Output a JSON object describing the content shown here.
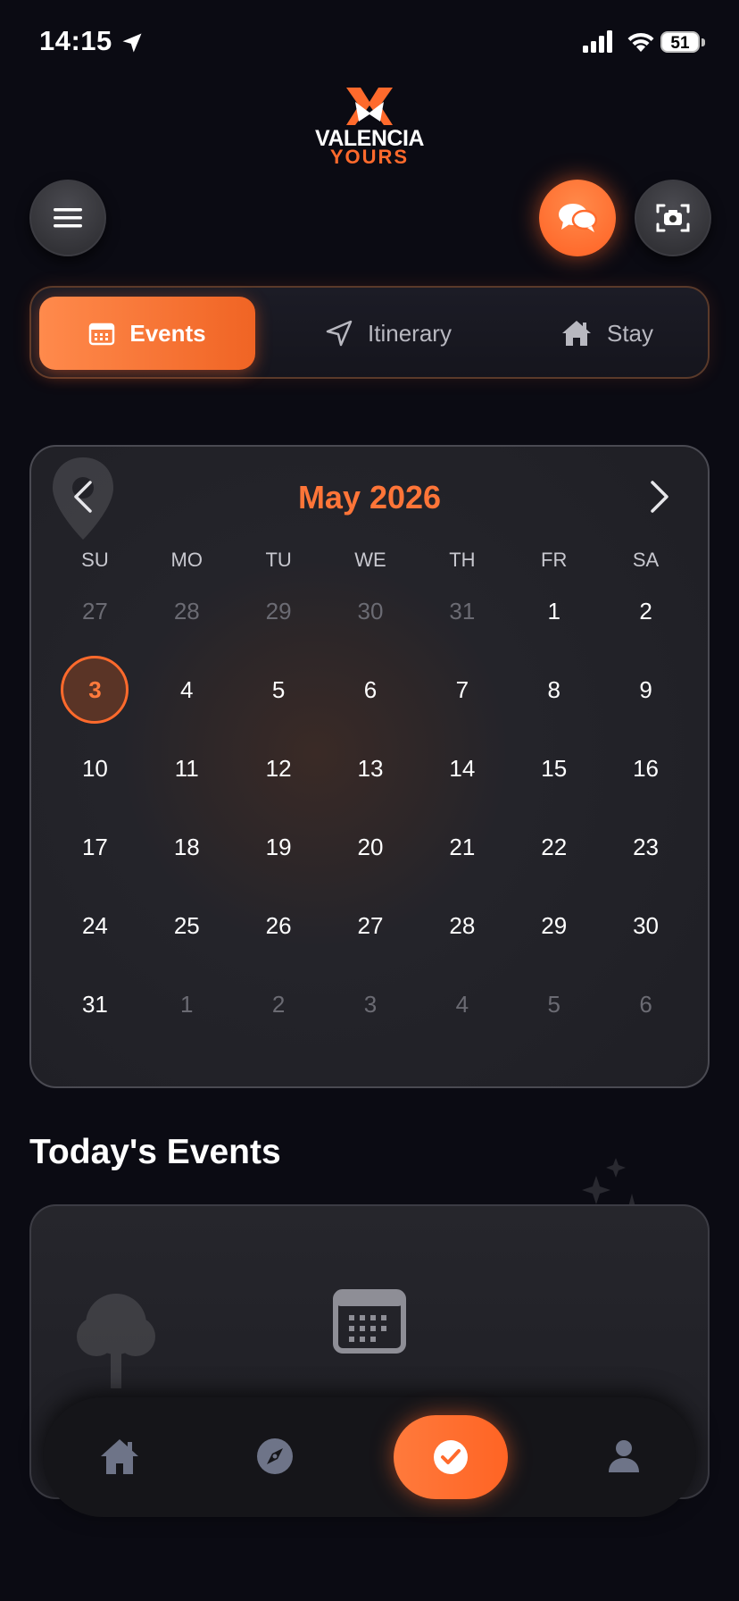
{
  "status_bar": {
    "time": "14:15",
    "battery": "51"
  },
  "brand": {
    "line1": "VALENCIA",
    "line2": "YOURS",
    "accent_color": "#ff6a2c"
  },
  "header": {
    "menu_icon": "hamburger-icon",
    "chat_icon": "chat-bubbles-icon",
    "camera_icon": "scan-camera-icon"
  },
  "tabs": [
    {
      "label": "Events",
      "icon": "calendar-icon",
      "active": true
    },
    {
      "label": "Itinerary",
      "icon": "navigation-arrow-icon",
      "active": false
    },
    {
      "label": "Stay",
      "icon": "house-icon",
      "active": false
    }
  ],
  "calendar": {
    "month_label": "May 2026",
    "weekdays": [
      "SU",
      "MO",
      "TU",
      "WE",
      "TH",
      "FR",
      "SA"
    ],
    "days": [
      {
        "d": "27",
        "muted": true
      },
      {
        "d": "28",
        "muted": true
      },
      {
        "d": "29",
        "muted": true
      },
      {
        "d": "30",
        "muted": true
      },
      {
        "d": "31",
        "muted": true
      },
      {
        "d": "1"
      },
      {
        "d": "2"
      },
      {
        "d": "3",
        "today": true
      },
      {
        "d": "4"
      },
      {
        "d": "5"
      },
      {
        "d": "6"
      },
      {
        "d": "7"
      },
      {
        "d": "8"
      },
      {
        "d": "9"
      },
      {
        "d": "10"
      },
      {
        "d": "11"
      },
      {
        "d": "12"
      },
      {
        "d": "13"
      },
      {
        "d": "14"
      },
      {
        "d": "15"
      },
      {
        "d": "16"
      },
      {
        "d": "17"
      },
      {
        "d": "18"
      },
      {
        "d": "19"
      },
      {
        "d": "20"
      },
      {
        "d": "21"
      },
      {
        "d": "22"
      },
      {
        "d": "23"
      },
      {
        "d": "24"
      },
      {
        "d": "25"
      },
      {
        "d": "26"
      },
      {
        "d": "27"
      },
      {
        "d": "28"
      },
      {
        "d": "29"
      },
      {
        "d": "30"
      },
      {
        "d": "31"
      },
      {
        "d": "1",
        "muted": true
      },
      {
        "d": "2",
        "muted": true
      },
      {
        "d": "3",
        "muted": true
      },
      {
        "d": "4",
        "muted": true
      },
      {
        "d": "5",
        "muted": true
      },
      {
        "d": "6",
        "muted": true
      }
    ]
  },
  "events_section": {
    "title": "Today's Events",
    "empty_icon": "calendar-grid-icon"
  },
  "bottom_nav": [
    {
      "name": "home",
      "icon": "home-icon",
      "active": false
    },
    {
      "name": "explore",
      "icon": "compass-icon",
      "active": false
    },
    {
      "name": "tasks",
      "icon": "check-circle-icon",
      "active": true
    },
    {
      "name": "profile",
      "icon": "person-icon",
      "active": false
    }
  ]
}
